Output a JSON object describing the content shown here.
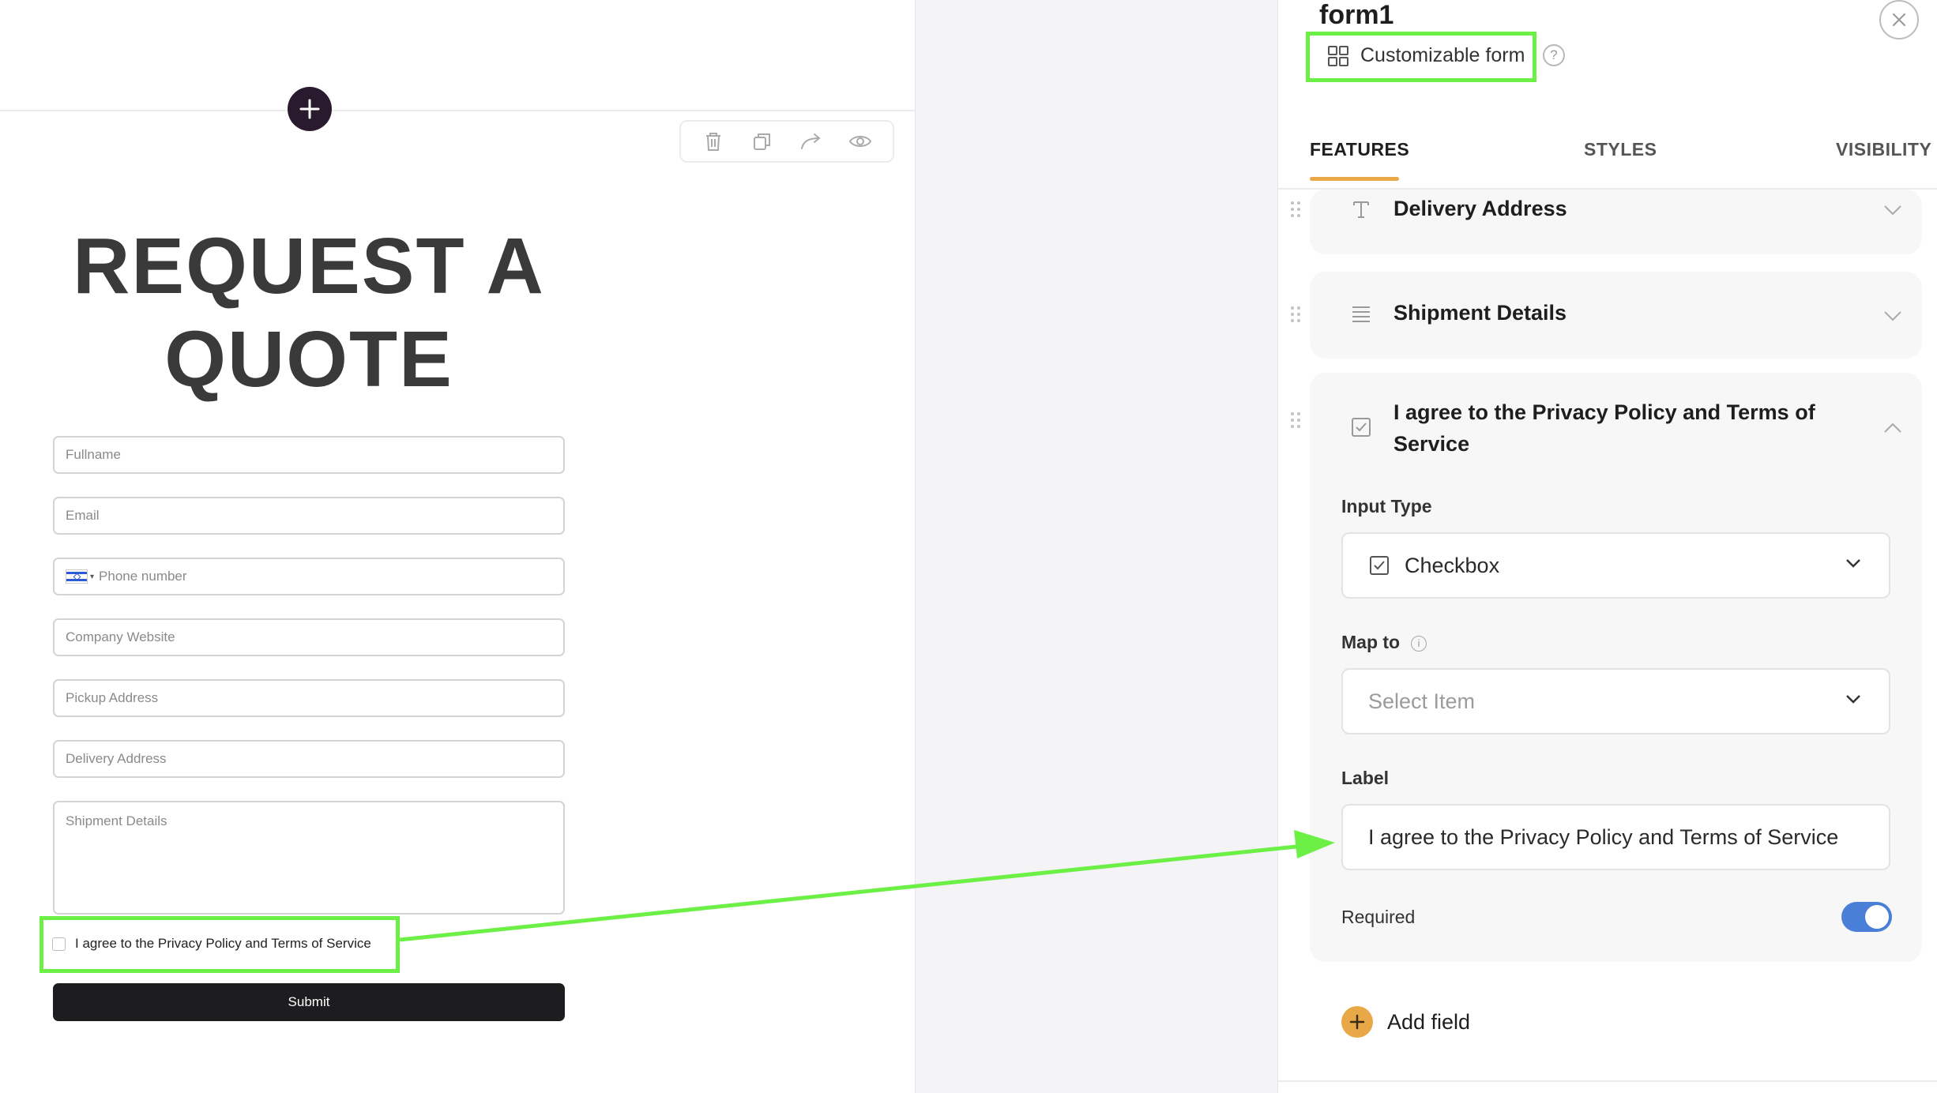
{
  "canvas": {
    "title_line1": "REQUEST A",
    "title_line2": "QUOTE",
    "fields": {
      "fullname": "Fullname",
      "email": "Email",
      "phone": "Phone number",
      "company": "Company Website",
      "pickup": "Pickup Address",
      "delivery": "Delivery Address",
      "shipment": "Shipment Details"
    },
    "consent_label": "I agree to the Privacy Policy and Terms of Service",
    "submit_label": "Submit",
    "toolbar": {
      "icons": [
        "trash-icon",
        "duplicate-icon",
        "share-icon",
        "eye-icon"
      ]
    }
  },
  "panel": {
    "title": "form1",
    "subtitle": "Customizable form",
    "help": "?",
    "tabs": [
      "FEATURES",
      "STYLES",
      "VISIBILITY"
    ],
    "active_tab": "FEATURES",
    "items": [
      {
        "label": "Delivery Address",
        "icon": "text-icon"
      },
      {
        "label": "Shipment Details",
        "icon": "paragraph-icon"
      },
      {
        "label_line1": "I agree to the Privacy Policy and Terms of",
        "label_line2": "Service",
        "icon": "checkbox-icon"
      }
    ],
    "settings": {
      "input_type_label": "Input Type",
      "input_type_value": "Checkbox",
      "map_to_label": "Map to",
      "map_to_placeholder": "Select Item",
      "label_label": "Label",
      "label_value": "I agree to the Privacy Policy and Terms of Service",
      "required_label": "Required",
      "required": true
    },
    "add_field": "Add field"
  },
  "colors": {
    "highlight": "#6cf046",
    "accent": "#e8a848",
    "toggle": "#4a7fd8",
    "submit_bg": "#1d1d1f"
  }
}
